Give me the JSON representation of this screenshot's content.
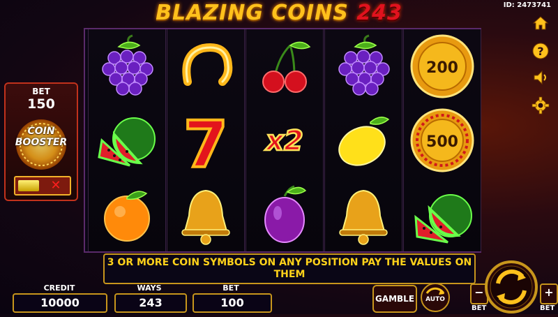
{
  "title": {
    "main": "BLAZING COINS",
    "number": "243"
  },
  "game_id": "ID: 2473741",
  "bet_panel": {
    "label": "BET",
    "value": "150",
    "booster_line1": "COIN",
    "booster_line2": "BOOSTER",
    "toggle_off": "✕"
  },
  "reels": [
    [
      "grapes",
      "watermelon",
      "orange"
    ],
    [
      "horseshoe",
      "seven",
      "bell"
    ],
    [
      "cherries",
      "x2",
      "plum"
    ],
    [
      "grapes",
      "lemon",
      "bell"
    ],
    [
      "coin",
      "coin",
      "watermelon"
    ]
  ],
  "coins": {
    "c1": "200",
    "c2": "500"
  },
  "x2_label": "x2",
  "seven_label": "7",
  "message": "3 OR MORE COIN SYMBOLS ON ANY POSITION PAY THE VALUES ON THEM",
  "bottom": {
    "credit_label": "CREDIT",
    "credit_value": "10000",
    "ways_label": "WAYS",
    "ways_value": "243",
    "bet_label": "BET",
    "bet_value": "100",
    "gamble_label": "GAMBLE",
    "auto_label": "AUTO",
    "minus": "−",
    "plus": "+",
    "minus_label": "BET",
    "plus_label": "BET"
  },
  "right_buttons": [
    "home-icon",
    "help-icon",
    "sound-icon",
    "settings-icon"
  ],
  "colors": {
    "gold": "#ffc11c",
    "red": "#e0121e",
    "border": "#c8961c"
  }
}
